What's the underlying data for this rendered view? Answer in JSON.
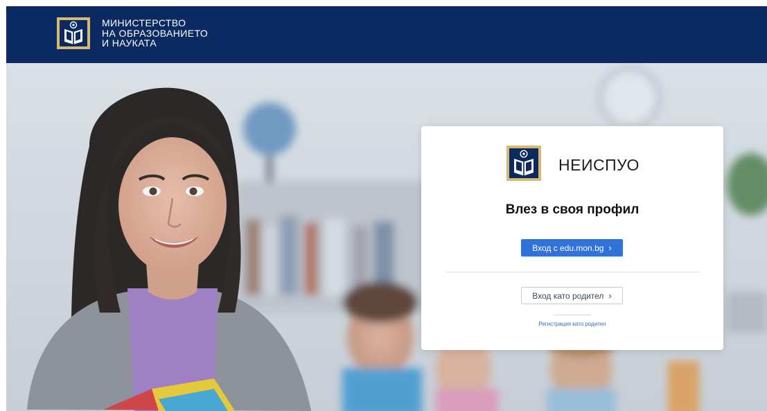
{
  "header": {
    "org_name_lines": [
      "МИНИСТЕРСТВО",
      "НА ОБРАЗОВАНИЕТО",
      "И НАУКАТА"
    ],
    "logo_icon": "ministry-book-logo",
    "background_color": "#0b2a62"
  },
  "login_card": {
    "app_name": "НЕИСПУО",
    "heading": "Влез в своя профил",
    "primary_button_label": "Вход с edu.mon.bg",
    "secondary_button_label": "Вход като родител",
    "register_link_label": "Регистрация като родител",
    "chevron_icon": "chevron-right-icon",
    "accent_color": "#2f73d9"
  },
  "hero": {
    "image": "teacher-and-students-classroom-photo"
  }
}
